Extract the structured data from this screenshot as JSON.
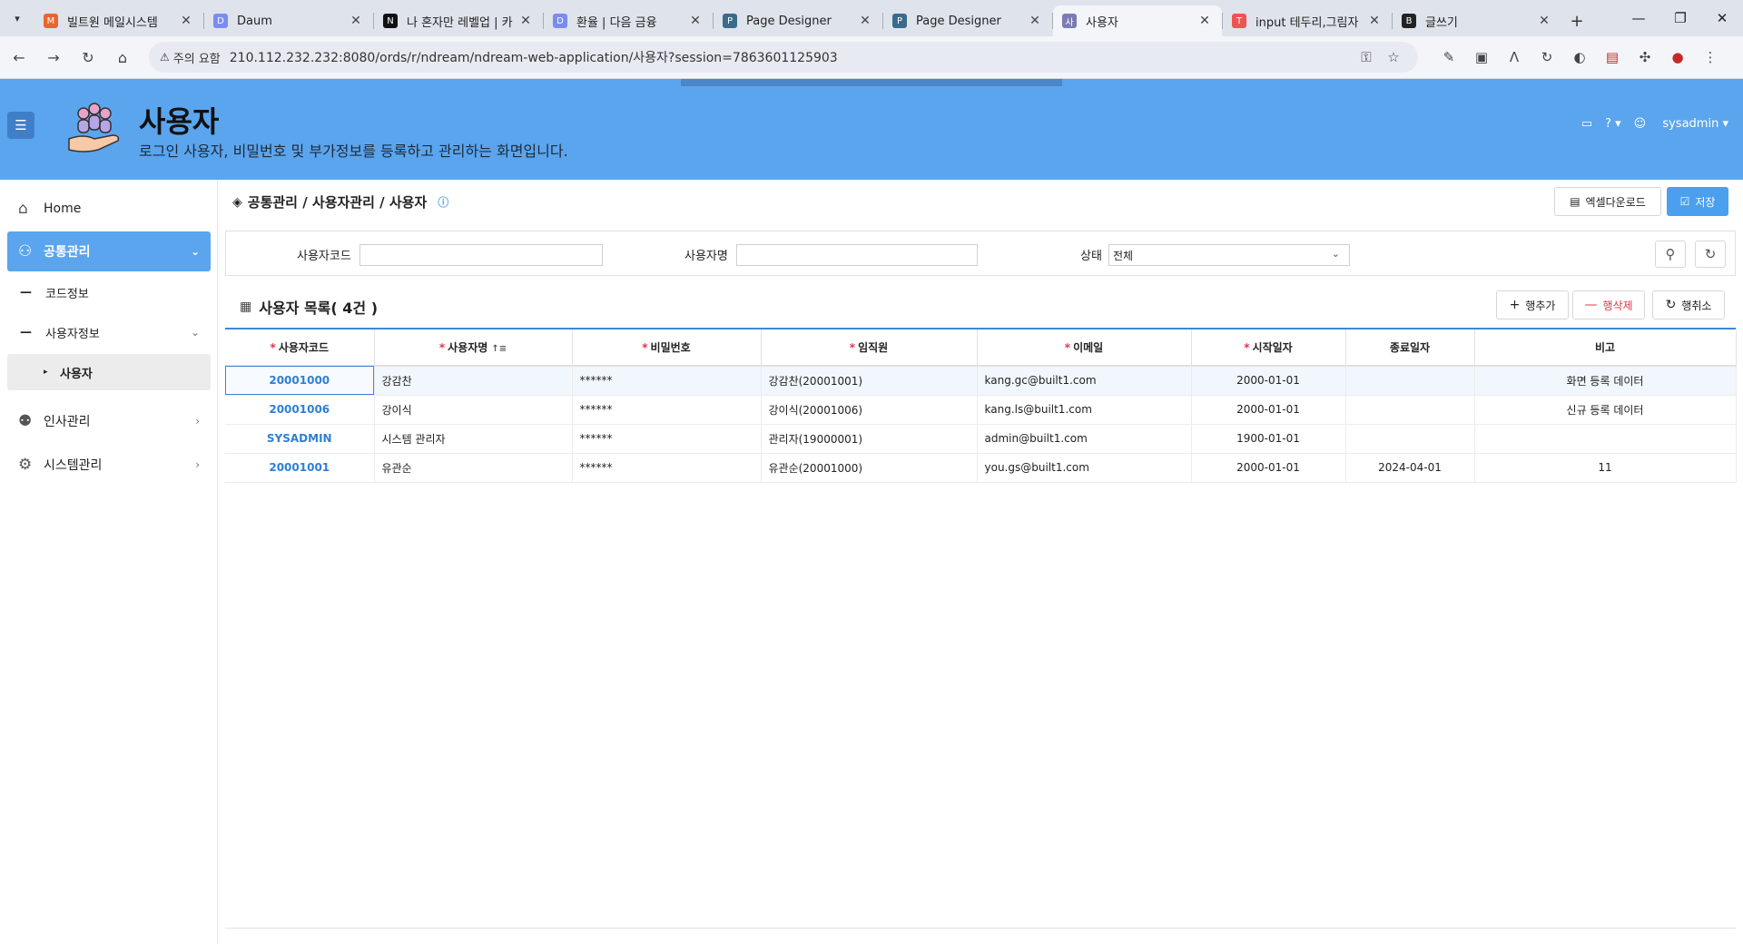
{
  "browser": {
    "tabs": [
      {
        "title": "빌트원 메일시스템",
        "favicon_color": "#e8662e",
        "favicon_glyph": "M"
      },
      {
        "title": "Daum",
        "favicon_color": "#7b8cf0",
        "favicon_glyph": "D"
      },
      {
        "title": "나 혼자만 레벨업 | 카",
        "favicon_color": "#111111",
        "favicon_glyph": "N"
      },
      {
        "title": "환율 | 다음 금융",
        "favicon_color": "#7b8cf0",
        "favicon_glyph": "D"
      },
      {
        "title": "Page Designer",
        "favicon_color": "#3b6b8a",
        "favicon_glyph": "P"
      },
      {
        "title": "Page Designer",
        "favicon_color": "#3b6b8a",
        "favicon_glyph": "P"
      },
      {
        "title": "사용자",
        "favicon_color": "#7b7bb5",
        "favicon_glyph": "사"
      },
      {
        "title": "input 테두리,그림자",
        "favicon_color": "#ef5350",
        "favicon_glyph": "T"
      },
      {
        "title": "글쓰기",
        "favicon_color": "#222222",
        "favicon_glyph": "B"
      }
    ],
    "active_tab_index": 6,
    "security_label": "주의 요함",
    "url": "210.112.232.232:8080/ords/r/ndream/ndream-web-application/사용자?session=7863601125903"
  },
  "header": {
    "title": "사용자",
    "subtitle": "로그인 사용자, 비밀번호 및 부가정보를 등록하고 관리하는 화면입니다.",
    "user": "sysadmin"
  },
  "sidebar": {
    "items": [
      {
        "label": "Home",
        "icon": "home-icon"
      },
      {
        "label": "공통관리",
        "icon": "share-icon"
      },
      {
        "label": "코드정보"
      },
      {
        "label": "사용자정보"
      },
      {
        "label": "사용자"
      },
      {
        "label": "인사관리",
        "icon": "people-icon"
      },
      {
        "label": "시스템관리",
        "icon": "gear-icon"
      }
    ]
  },
  "breadcrumb": "공통관리 / 사용자관리 / 사용자",
  "toolbar": {
    "excel_label": "엑셀다운로드",
    "save_label": "저장"
  },
  "search": {
    "code_label": "사용자코드",
    "code_value": "",
    "name_label": "사용자명",
    "name_value": "",
    "status_label": "상태",
    "status_value": "전체"
  },
  "list": {
    "title": "사용자 목록( 4건 )",
    "add_label": "행추가",
    "delete_label": "행삭제",
    "cancel_label": "행취소"
  },
  "table": {
    "headers": [
      "사용자코드",
      "사용자명",
      "비밀번호",
      "임직원",
      "이메일",
      "시작일자",
      "종료일자",
      "비고"
    ],
    "rows": [
      [
        "20001000",
        "강감찬",
        "******",
        "강감찬(20001001)",
        "kang.gc@built1.com",
        "2000-01-01",
        "",
        "화면 등록 데이터"
      ],
      [
        "20001006",
        "강이식",
        "******",
        "강이식(20001006)",
        "kang.ls@built1.com",
        "2000-01-01",
        "",
        "신규 등록 데이터"
      ],
      [
        "SYSADMIN",
        "시스템 관리자",
        "******",
        "관리자(19000001)",
        "admin@built1.com",
        "1900-01-01",
        "",
        ""
      ],
      [
        "20001001",
        "유관순",
        "******",
        "유관순(20001000)",
        "you.gs@built1.com",
        "2000-01-01",
        "2024-04-01",
        "11"
      ]
    ]
  },
  "colors": {
    "header_bg": "#5aa5ee",
    "accent": "#4aa0ee",
    "required": "#e0344b",
    "link": "#2f7fd3"
  }
}
